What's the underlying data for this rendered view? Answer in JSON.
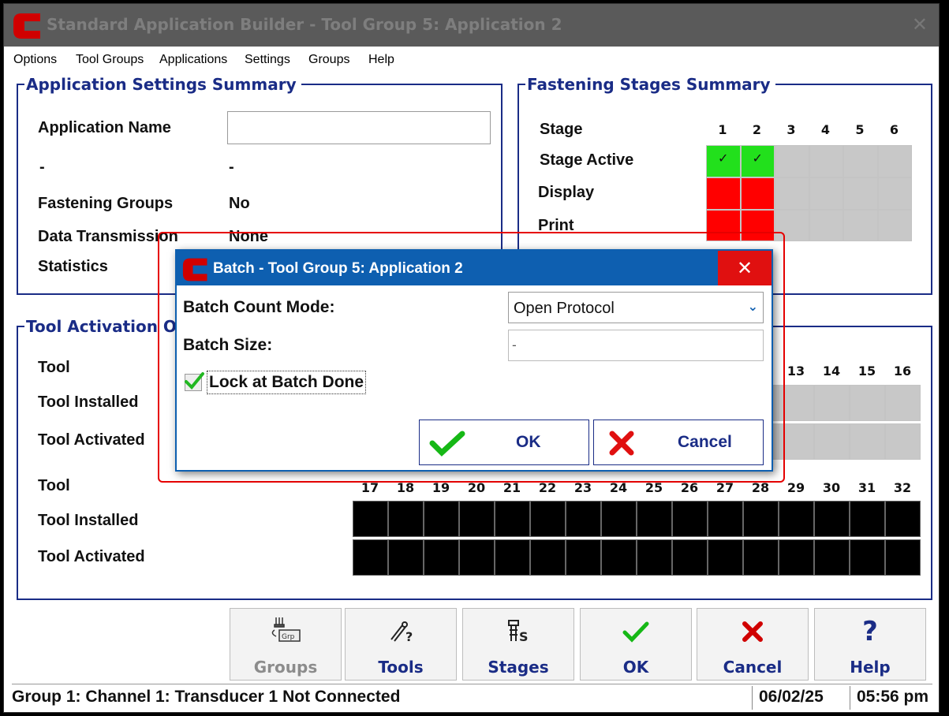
{
  "window": {
    "title": "Standard Application Builder - Tool Group 5: Application 2",
    "close_glyph": "✕"
  },
  "menu": [
    "Options",
    "Tool Groups",
    "Applications",
    "Settings",
    "Groups",
    "Help"
  ],
  "app_settings": {
    "title": "Application Settings Summary",
    "name_label": "Application Name",
    "name_value": "",
    "dash_label": "-",
    "dash_value": "-",
    "fastening_groups_label": "Fastening Groups",
    "fastening_groups_value": "No",
    "data_transmission_label": "Data Transmission",
    "data_transmission_value": "None",
    "statistics_label": "Statistics"
  },
  "stages": {
    "title": "Fastening Stages Summary",
    "stage_label": "Stage",
    "stage_active_label": "Stage Active",
    "display_label": "Display",
    "print_label": "Print",
    "numbers": [
      "1",
      "2",
      "3",
      "4",
      "5",
      "6"
    ],
    "active": [
      true,
      true,
      false,
      false,
      false,
      false
    ],
    "display": [
      true,
      true,
      false,
      false,
      false,
      false
    ],
    "print": [
      true,
      true,
      false,
      false,
      false,
      false
    ],
    "check_glyph": "✓",
    "colors": {
      "active": "#22e01c",
      "flag": "#ff0000",
      "off": "#c8c8c8"
    }
  },
  "tools": {
    "title": "Tool Activation O",
    "tool_label": "Tool",
    "installed_label": "Tool Installed",
    "activated_label": "Tool Activated",
    "row1_numbers_visible": [
      "13",
      "14",
      "15",
      "16"
    ],
    "row2_numbers": [
      "17",
      "18",
      "19",
      "20",
      "21",
      "22",
      "23",
      "24",
      "25",
      "26",
      "27",
      "28",
      "29",
      "30",
      "31",
      "32"
    ]
  },
  "buttons": [
    {
      "label": "Groups",
      "icon": "groups-icon",
      "enabled": false
    },
    {
      "label": "Tools",
      "icon": "tools-icon",
      "enabled": true
    },
    {
      "label": "Stages",
      "icon": "stages-icon",
      "enabled": true
    },
    {
      "label": "OK",
      "icon": "checkmark-icon",
      "enabled": true
    },
    {
      "label": "Cancel",
      "icon": "x-icon",
      "enabled": true
    },
    {
      "label": "Help",
      "icon": "question-icon",
      "enabled": true
    }
  ],
  "status": {
    "message": "Group 1: Channel 1: Transducer 1 Not Connected",
    "date": "06/02/25",
    "time": "05:56 pm"
  },
  "dialog": {
    "title": "Batch - Tool Group 5: Application 2",
    "close_glyph": "✕",
    "batch_count_mode_label": "Batch Count Mode:",
    "batch_count_mode_value": "Open Protocol",
    "batch_size_label": "Batch Size:",
    "batch_size_value": "-",
    "lock_label": "Lock at Batch Done",
    "lock_checked": true,
    "ok_label": "OK",
    "cancel_label": "Cancel"
  }
}
